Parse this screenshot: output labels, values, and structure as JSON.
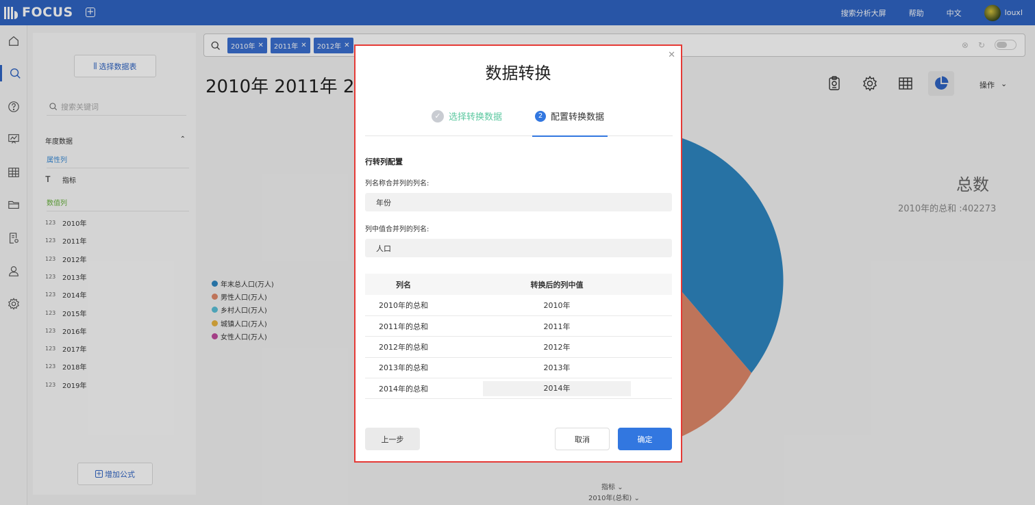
{
  "topbar": {
    "logo_text": "FOCUS",
    "links": [
      "搜索分析大屏",
      "帮助",
      "中文"
    ],
    "user": "louxl"
  },
  "rail": [
    "home-icon",
    "search-icon",
    "help-icon",
    "dashboard-icon",
    "table-icon",
    "folder-icon",
    "settings-doc-icon",
    "user-icon",
    "gear-icon"
  ],
  "panel": {
    "select_table": "选择数据表",
    "search_placeholder": "搜索关键词",
    "group": "年度数据",
    "attr_section": "属性列",
    "attr_fields": [
      "指标"
    ],
    "num_section": "数值列",
    "num_fields": [
      "2010年",
      "2011年",
      "2012年",
      "2013年",
      "2014年",
      "2015年",
      "2016年",
      "2017年",
      "2018年",
      "2019年"
    ],
    "num_type": "123",
    "add_formula": "增加公式"
  },
  "search": {
    "tokens": [
      "2010年",
      "2011年",
      "2012年"
    ]
  },
  "main": {
    "title": "2010年 2011年 2012年",
    "operations": "操作",
    "legend": [
      {
        "label": "年末总人口(万人)",
        "color": "#2e86c1"
      },
      {
        "label": "男性人口(万人)",
        "color": "#e0896a"
      },
      {
        "label": "乡村人口(万人)",
        "color": "#5bc0d8"
      },
      {
        "label": "城镇人口(万人)",
        "color": "#e9b43f"
      },
      {
        "label": "女性人口(万人)",
        "color": "#c04a9e"
      }
    ],
    "kpi_title": "总数",
    "kpi_value": "2010年的总和 :402273",
    "axis_attr": "指标",
    "axis_measure": "2010年(总和)"
  },
  "modal": {
    "title": "数据转换",
    "step1": "选择转换数据",
    "step2_num": "2",
    "step2": "配置转换数据",
    "section": "行转列配置",
    "name_label": "列名称合并列的列名:",
    "name_value": "年份",
    "value_label": "列中值合并列的列名:",
    "value_value": "人口",
    "table_headers": [
      "列名",
      "转换后的列中值"
    ],
    "rows": [
      [
        "2010年的总和",
        "2010年"
      ],
      [
        "2011年的总和",
        "2011年"
      ],
      [
        "2012年的总和",
        "2012年"
      ],
      [
        "2013年的总和",
        "2013年"
      ],
      [
        "2014年的总和",
        "2014年"
      ]
    ],
    "prev": "上一步",
    "cancel": "取消",
    "ok": "确定"
  }
}
